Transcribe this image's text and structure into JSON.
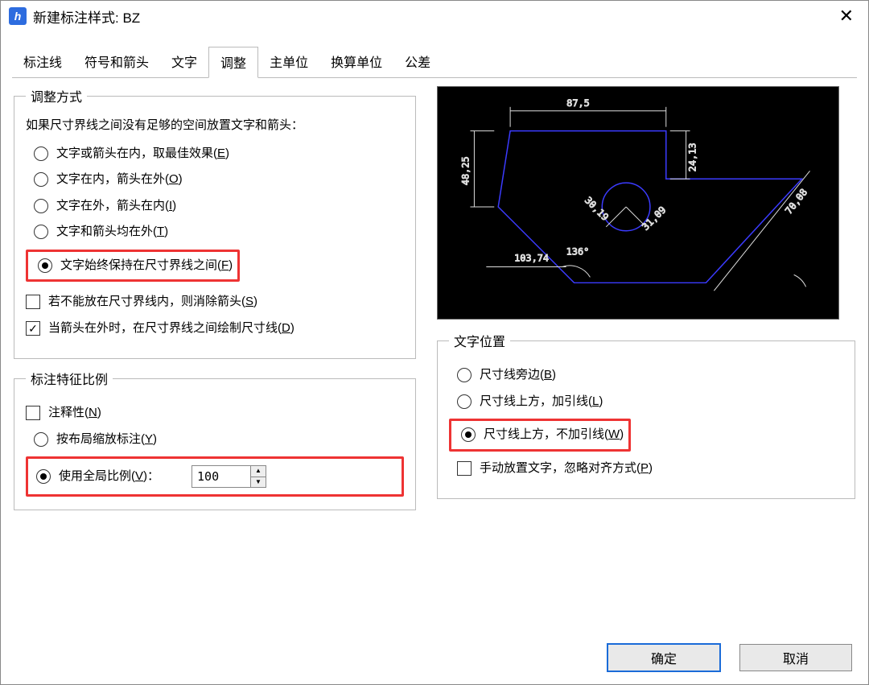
{
  "window": {
    "title": "新建标注样式: BZ"
  },
  "tabs": [
    "标注线",
    "符号和箭头",
    "文字",
    "调整",
    "主单位",
    "换算单位",
    "公差"
  ],
  "active_tab": 3,
  "fit_method": {
    "legend": "调整方式",
    "intro": "如果尺寸界线之间没有足够的空间放置文字和箭头：",
    "options": {
      "best_fit": {
        "label": "文字或箭头在内，取最佳效果(",
        "hot": "E",
        "tail": ")",
        "on": false
      },
      "text_in_arr_out": {
        "label": "文字在内，箭头在外(",
        "hot": "O",
        "tail": ")",
        "on": false
      },
      "text_out_arr_in": {
        "label": "文字在外，箭头在内(",
        "hot": "I",
        "tail": ")",
        "on": false
      },
      "both_out": {
        "label": "文字和箭头均在外(",
        "hot": "T",
        "tail": ")",
        "on": false
      },
      "keep_between": {
        "label": "文字始终保持在尺寸界线之间(",
        "hot": "F",
        "tail": ")",
        "on": true
      }
    },
    "suppress_arrows": {
      "label": "若不能放在尺寸界线内，则消除箭头(",
      "hot": "S",
      "tail": ")",
      "on": false
    },
    "draw_dim_line": {
      "label": "当箭头在外时，在尺寸界线之间绘制尺寸线(",
      "hot": "D",
      "tail": ")",
      "on": true
    }
  },
  "scale": {
    "legend": "标注特征比例",
    "annotative": {
      "label": "注释性(",
      "hot": "N",
      "tail": ")",
      "on": false
    },
    "by_layout": {
      "label": "按布局缩放标注(",
      "hot": "Y",
      "tail": ")",
      "on": false
    },
    "global": {
      "label": "使用全局比例(",
      "hot": "V",
      "tail": ")：",
      "on": true,
      "value": "100"
    }
  },
  "text_pos": {
    "legend": "文字位置",
    "beside": {
      "label": "尺寸线旁边(",
      "hot": "B",
      "tail": ")",
      "on": false
    },
    "above_leader": {
      "label": "尺寸线上方，加引线(",
      "hot": "L",
      "tail": ")",
      "on": false
    },
    "above_no_l": {
      "label": "尺寸线上方，不加引线(",
      "hot": "W",
      "tail": ")",
      "on": true
    },
    "manual": {
      "label": "手动放置文字，忽略对齐方式(",
      "hot": "P",
      "tail": ")",
      "on": false
    }
  },
  "preview_values": {
    "top": "87,5",
    "left": "48,25",
    "right_v": "24,13",
    "diag": "70,08",
    "bottom": "103,74",
    "angle": "136°",
    "circ_a": "30,19",
    "circ_b": "31,09"
  },
  "buttons": {
    "ok": "确定",
    "cancel": "取消"
  }
}
